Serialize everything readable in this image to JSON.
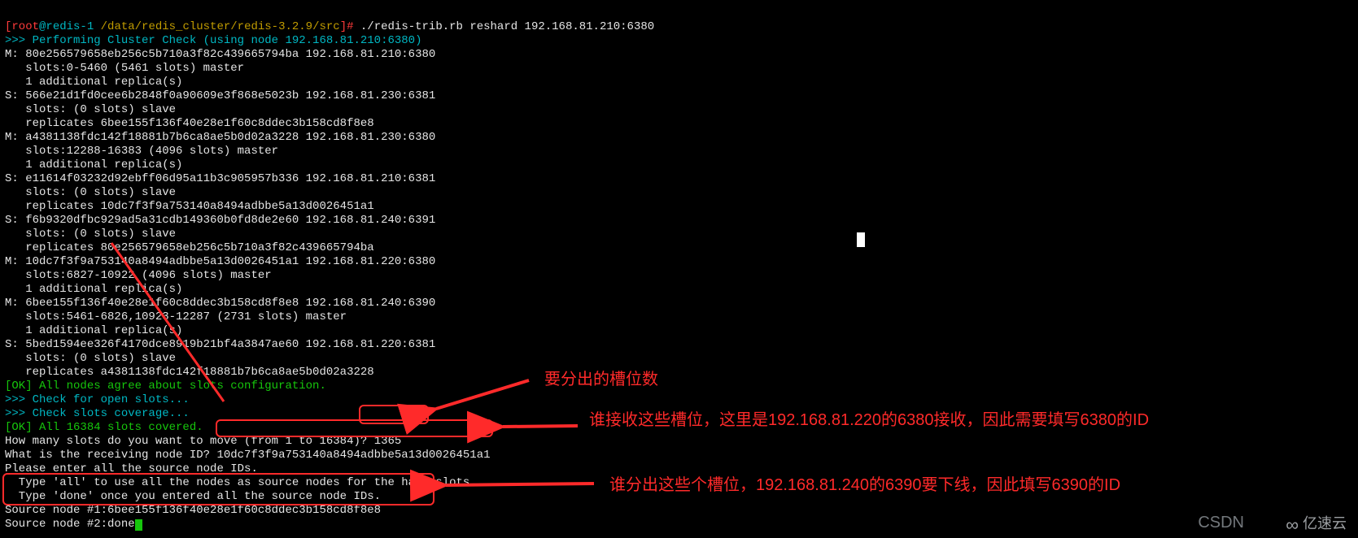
{
  "prompt": {
    "bracket_open": "[",
    "user": "root",
    "at": "@",
    "host": "redis-1",
    "path": " /data/redis_cluster/redis-3.2.9/src",
    "bracket_close": "]# ",
    "command": "./redis-trib.rb reshard 192.168.81.210:6380"
  },
  "lines": {
    "l01": ">>> Performing Cluster Check (using node 192.168.81.210:6380)",
    "l02": "M: 80e256579658eb256c5b710a3f82c439665794ba 192.168.81.210:6380",
    "l03": "   slots:0-5460 (5461 slots) master",
    "l04": "   1 additional replica(s)",
    "l05": "S: 566e21d1fd0cee6b2848f0a90609e3f868e5023b 192.168.81.230:6381",
    "l06": "   slots: (0 slots) slave",
    "l07": "   replicates 6bee155f136f40e28e1f60c8ddec3b158cd8f8e8",
    "l08": "M: a4381138fdc142f18881b7b6ca8ae5b0d02a3228 192.168.81.230:6380",
    "l09": "   slots:12288-16383 (4096 slots) master",
    "l10": "   1 additional replica(s)",
    "l11": "S: e11614f03232d92ebff06d95a11b3c905957b336 192.168.81.210:6381",
    "l12": "   slots: (0 slots) slave",
    "l13": "   replicates 10dc7f3f9a753140a8494adbbe5a13d0026451a1",
    "l14": "S: f6b9320dfbc929ad5a31cdb149360b0fd8de2e60 192.168.81.240:6391",
    "l15": "   slots: (0 slots) slave",
    "l16": "   replicates 80e256579658eb256c5b710a3f82c439665794ba",
    "l17": "M: 10dc7f3f9a753140a8494adbbe5a13d0026451a1 192.168.81.220:6380",
    "l18": "   slots:6827-10922 (4096 slots) master",
    "l19": "   1 additional replica(s)",
    "l20": "M: 6bee155f136f40e28e1f60c8ddec3b158cd8f8e8 192.168.81.240:6390",
    "l21": "   slots:5461-6826,10923-12287 (2731 slots) master",
    "l22": "   1 additional replica(s)",
    "l23": "S: 5bed1594ee326f4170dce8919b21bf4a3847ae60 192.168.81.220:6381",
    "l24": "   slots: (0 slots) slave",
    "l25": "   replicates a4381138fdc142f18881b7b6ca8ae5b0d02a3228",
    "l26": "[OK] All nodes agree about slots configuration.",
    "l27": ">>> Check for open slots...",
    "l28": ">>> Check slots coverage...",
    "l29": "[OK] All 16384 slots covered.",
    "l30a": "How many slots do you want to move (from 1 to 16384)? ",
    "l30b": "1365",
    "l31a": "What is the receiving node ID? ",
    "l31b": "10dc7f3f9a753140a8494adbbe5a13d0026451a1",
    "l32": "Please enter all the source node IDs.",
    "l33": "  Type 'all' to use all the nodes as source nodes for the hash slots.",
    "l34": "  Type 'done' once you entered all the source node IDs.",
    "l35": "Source node #1:6bee155f136f40e28e1f60c8ddec3b158cd8f8e8",
    "l36": "Source node #2:done"
  },
  "annotations": {
    "a1": "要分出的槽位数",
    "a2": "谁接收这些槽位，这里是192.168.81.220的6380接收，因此需要填写6380的ID",
    "a3": "谁分出这些个槽位，192.168.81.240的6390要下线，因此填写6390的ID"
  },
  "watermarks": {
    "csdn": "CSDN",
    "yisu": "亿速云"
  }
}
